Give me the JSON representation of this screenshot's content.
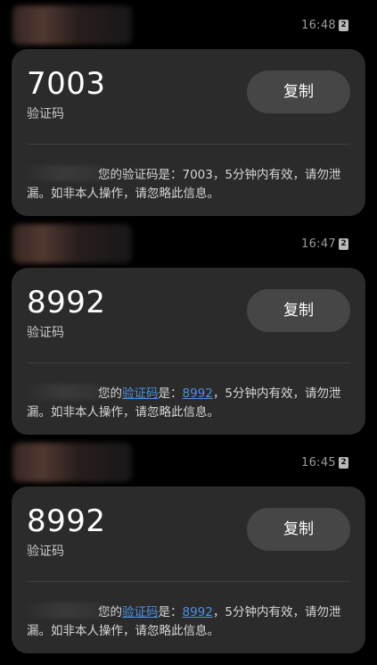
{
  "messages": [
    {
      "time": "16:48",
      "sim": "2",
      "code": "7003",
      "code_label": "验证码",
      "copy_label": "复制",
      "body_a": "您的验证码是：7003，5分钟内有效，请勿泄漏。如非本人操作，请忽略此信息。"
    },
    {
      "time": "16:47",
      "sim": "2",
      "code": "8992",
      "code_label": "验证码",
      "copy_label": "复制",
      "body_pre": "您的",
      "body_link1": "验证码",
      "body_mid": "是：",
      "body_link2": "8992",
      "body_post": "，5分钟内有效，请勿泄漏。如非本人操作，请忽略此信息。"
    },
    {
      "time": "16:45",
      "sim": "2",
      "code": "8992",
      "code_label": "验证码",
      "copy_label": "复制",
      "body_pre": "您的",
      "body_link1": "验证码",
      "body_mid": "是：",
      "body_link2": "8992",
      "body_post": "，5分钟内有效，请勿泄漏。如非本人操作，请忽略此信息。"
    }
  ],
  "colors": {
    "background": "#000000",
    "card": "#2b2b2b",
    "button": "#464646",
    "link": "#4d8fe3"
  }
}
